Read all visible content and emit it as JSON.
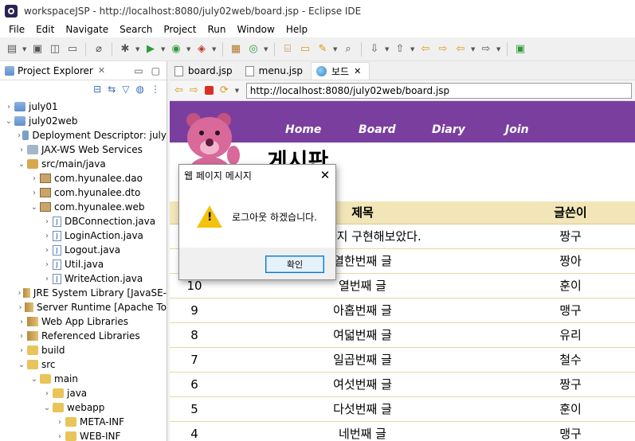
{
  "window": {
    "title": "workspaceJSP - http://localhost:8080/july02web/board.jsp - Eclipse IDE"
  },
  "menubar": [
    "File",
    "Edit",
    "Navigate",
    "Search",
    "Project",
    "Run",
    "Window",
    "Help"
  ],
  "left_panel": {
    "title": "Project Explorer",
    "close": "✕",
    "tree": [
      {
        "label": "july01",
        "arrow": "›",
        "indent": 0,
        "icon": "ico-project"
      },
      {
        "label": "july02web",
        "arrow": "⌄",
        "indent": 0,
        "icon": "ico-project"
      },
      {
        "label": "Deployment Descriptor: july",
        "arrow": "›",
        "indent": 1,
        "icon": "ico-dd"
      },
      {
        "label": "JAX-WS Web Services",
        "arrow": "›",
        "indent": 1,
        "icon": "ico-ws"
      },
      {
        "label": "src/main/java",
        "arrow": "⌄",
        "indent": 1,
        "icon": "ico-src"
      },
      {
        "label": "com.hyunalee.dao",
        "arrow": "›",
        "indent": 2,
        "icon": "ico-pkg"
      },
      {
        "label": "com.hyunalee.dto",
        "arrow": "›",
        "indent": 2,
        "icon": "ico-pkg"
      },
      {
        "label": "com.hyunalee.web",
        "arrow": "⌄",
        "indent": 2,
        "icon": "ico-pkg"
      },
      {
        "label": "DBConnection.java",
        "arrow": "›",
        "indent": 3,
        "icon": "ico-java"
      },
      {
        "label": "LoginAction.java",
        "arrow": "›",
        "indent": 3,
        "icon": "ico-java"
      },
      {
        "label": "Logout.java",
        "arrow": "›",
        "indent": 3,
        "icon": "ico-java"
      },
      {
        "label": "Util.java",
        "arrow": "›",
        "indent": 3,
        "icon": "ico-java"
      },
      {
        "label": "WriteAction.java",
        "arrow": "›",
        "indent": 3,
        "icon": "ico-java"
      },
      {
        "label": "JRE System Library [JavaSE-",
        "arrow": "›",
        "indent": 1,
        "icon": "ico-lib"
      },
      {
        "label": "Server Runtime [Apache To",
        "arrow": "›",
        "indent": 1,
        "icon": "ico-lib"
      },
      {
        "label": "Web App Libraries",
        "arrow": "›",
        "indent": 1,
        "icon": "ico-lib"
      },
      {
        "label": "Referenced Libraries",
        "arrow": "›",
        "indent": 1,
        "icon": "ico-lib"
      },
      {
        "label": "build",
        "arrow": "›",
        "indent": 1,
        "icon": "ico-folder"
      },
      {
        "label": "src",
        "arrow": "⌄",
        "indent": 1,
        "icon": "ico-folder"
      },
      {
        "label": "main",
        "arrow": "⌄",
        "indent": 2,
        "icon": "ico-folder"
      },
      {
        "label": "java",
        "arrow": "›",
        "indent": 3,
        "icon": "ico-folder"
      },
      {
        "label": "webapp",
        "arrow": "⌄",
        "indent": 3,
        "icon": "ico-folder"
      },
      {
        "label": "META-INF",
        "arrow": "›",
        "indent": 4,
        "icon": "ico-folder"
      },
      {
        "label": "WEB-INF",
        "arrow": "›",
        "indent": 4,
        "icon": "ico-folder"
      }
    ]
  },
  "editor": {
    "tabs": [
      {
        "label": "board.jsp",
        "active": false
      },
      {
        "label": "menu.jsp",
        "active": false
      },
      {
        "label": "보드",
        "active": true
      }
    ],
    "url": "http://localhost:8080/july02web/board.jsp"
  },
  "site": {
    "nav": [
      "Home",
      "Board",
      "Diary",
      "Join"
    ],
    "heading": "게시판",
    "header_color": "#7a3f9e",
    "table": {
      "headers": [
        "",
        "제목",
        "글쓴이"
      ],
      "rows": [
        {
          "no": "",
          "title": "삭제까지 구현해보았다.",
          "writer": "짱구"
        },
        {
          "no": "",
          "title": "열한번째 글",
          "writer": "짱아"
        },
        {
          "no": "10",
          "title": "열번째 글",
          "writer": "훈이"
        },
        {
          "no": "9",
          "title": "아홉번째 글",
          "writer": "맹구"
        },
        {
          "no": "8",
          "title": "여덟번째 글",
          "writer": "유리"
        },
        {
          "no": "7",
          "title": "일곱번째 글",
          "writer": "철수"
        },
        {
          "no": "6",
          "title": "여섯번째 글",
          "writer": "짱구"
        },
        {
          "no": "5",
          "title": "다섯번째 글",
          "writer": "훈이"
        },
        {
          "no": "4",
          "title": "네번째 글",
          "writer": "맹구"
        }
      ]
    }
  },
  "dialog": {
    "title": "웹 페이지 메시지",
    "message": "로그아웃 하겠습니다.",
    "ok": "확인"
  }
}
